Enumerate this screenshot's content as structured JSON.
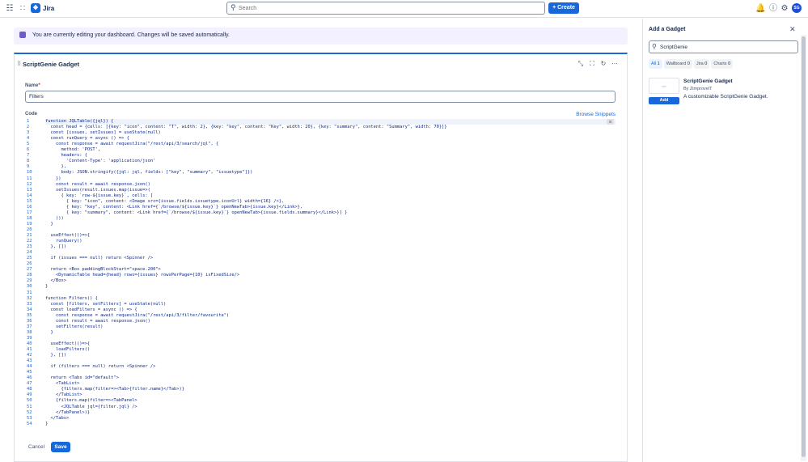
{
  "topbar": {
    "brand": "Jira",
    "search_placeholder": "Search",
    "create_label": "Create",
    "avatar_initials": "SG"
  },
  "banner": {
    "text": "You are currently editing your dashboard. Changes will be saved automatically."
  },
  "gadget": {
    "title": "ScriptGenie Gadget",
    "name_label": "Name",
    "name_required": "*",
    "name_value": "Filters",
    "code_label": "Code",
    "browse_snippets": "Browse Snippets",
    "cancel_label": "Cancel",
    "save_label": "Save"
  },
  "code": {
    "line_numbers": [
      "1",
      "2",
      "3",
      "4",
      "5",
      "6",
      "7",
      "8",
      "9",
      "10",
      "11",
      "12",
      "13",
      "14",
      "15",
      "16",
      "17",
      "18",
      "19",
      "20",
      "21",
      "22",
      "23",
      "24",
      "25",
      "26",
      "27",
      "28",
      "29",
      "30",
      "31",
      "32",
      "33",
      "34",
      "35",
      "36",
      "37",
      "38",
      "39",
      "40",
      "41",
      "42",
      "43",
      "44",
      "45",
      "46",
      "47",
      "48",
      "49",
      "50",
      "51",
      "52",
      "53",
      "54"
    ],
    "lines": [
      "function JQLTable({jql}) {",
      "  const head = {cells: [{key: \"icon\", content: \"T\", width: 2}, {key: \"key\", content: \"Key\", width: 20}, {key: \"summary\", content: \"Summary\", width: 70}]}",
      "  const [issues, setIssues] = useState(null)",
      "  const runQuery = async () => {",
      "    const response = await requestJira(\"/rest/api/3/search/jql\", {",
      "      method: 'POST',",
      "      headers: {",
      "        'Content-Type': 'application/json'",
      "      },",
      "      body: JSON.stringify({jql: jql, fields: [\"key\", \"summary\", \"issuetype\"]})",
      "    })",
      "    const result = await response.json()",
      "    setIssues(result.issues.map(issue=>(",
      "      { key: `row-${issue.key}`, cells: [",
      "        { key: \"icon\", content: <Image src={issue.fields.issuetype.iconUrl} width={16} />},",
      "        { key: \"key\", content: <Link href={`/browse/${issue.key}`} openNewTab>{issue.key}</Link>},",
      "        { key: \"summary\", content: <Link href={`/browse/${issue.key}`} openNewTab>{issue.fields.summary}</Link>}] }",
      "    )))",
      "  }",
      "",
      "  useEffect(()=>{",
      "    runQuery()",
      "  }, [])",
      "",
      "  if (issues === null) return <Spinner />",
      "",
      "  return <Box paddingBlockStart=\"space.200\">",
      "    <DynamicTable head={head} rows={issues} rowsPerPage={10} isFixedSize/>",
      "  </Box>",
      "}",
      "",
      "function Filters() {",
      "  const [filters, setFilters] = useState(null)",
      "  const loadFilters = async () => {",
      "    const response = await requestJira(\"/rest/api/3/filter/favourite\")",
      "    const result = await response.json()",
      "    setFilters(result)",
      "  }",
      "",
      "  useEffect(()=>{",
      "    loadFilters()",
      "  }, [])",
      "",
      "  if (filters === null) return <Spinner />",
      "",
      "  return <Tabs id=\"default\">",
      "    <TabList>",
      "      {filters.map(filter=><Tab>{filter.name}</Tab>)}",
      "    </TabList>",
      "    {filters.map(filter=><TabPanel>",
      "      <JQLTable jql={filter.jql} />",
      "    </TabPanel>)}",
      "  </Tabs>",
      "}"
    ]
  },
  "panel": {
    "title": "Add a Gadget",
    "search_value": "ScriptGenie",
    "filters": [
      {
        "label": "All",
        "count": "1"
      },
      {
        "label": "Wallboard",
        "count": "0"
      },
      {
        "label": "Jira",
        "count": "0"
      },
      {
        "label": "Charts",
        "count": "0"
      }
    ],
    "result": {
      "name": "ScriptGenie Gadget",
      "by": "By ZimprovelT",
      "description": "A customizable ScriptGenie Gadget.",
      "add_label": "Add",
      "thumb_text": "</>"
    }
  },
  "colors": {
    "accent": "#1868db",
    "banner_bg": "#f3f0ff",
    "code_text": "#0b2a8f"
  }
}
